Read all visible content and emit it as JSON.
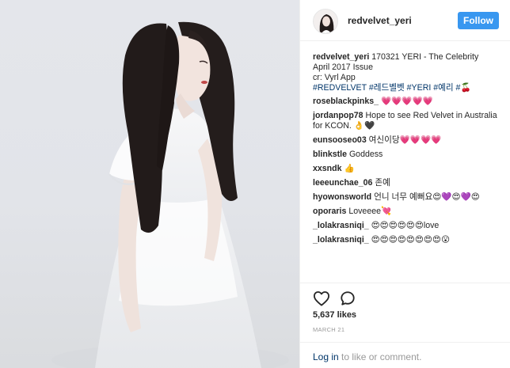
{
  "post": {
    "username": "redvelvet_yeri",
    "follow_label": "Follow",
    "caption": {
      "user": "redvelvet_yeri",
      "lines": [
        "170321 YERI - The Celebrity",
        "April 2017 Issue",
        "cr: Vyrl App"
      ],
      "hashtags": "#REDVELVET #레드벨벳 #YERI #예리 #🍒"
    },
    "comments": [
      {
        "user": "roseblackpinks_",
        "text": "💗💗💗💗💗"
      },
      {
        "user": "jordanpop78",
        "text": "Hope to see Red Velvet in Australia for KCON. 👌🖤"
      },
      {
        "user": "eunsooseo03",
        "text": "여신이당💗💗💗💗"
      },
      {
        "user": "blinkstle",
        "text": "Goddess"
      },
      {
        "user": "xxsndk",
        "text": "👍"
      },
      {
        "user": "leeeunchae_06",
        "text": "존예"
      },
      {
        "user": "hyowonsworld",
        "text": "언니 너무 예뻐요😍💜😍💜😍"
      },
      {
        "user": "oporaris",
        "text": "Loveeee💘"
      },
      {
        "user": "_lolakrasniqi_",
        "text": "😍😍😍😍😍😍love"
      },
      {
        "user": "_lolakrasniqi_",
        "text": "😍😍😍😍😍😍😍😍😮"
      }
    ],
    "likes": "5,637 likes",
    "date": "MARCH 21",
    "login": {
      "link": "Log in",
      "rest": " to like or comment."
    }
  },
  "icons": {
    "like": "heart-outline-icon",
    "comment": "speech-bubble-icon"
  },
  "colors": {
    "follow_button": "#3897f0",
    "link": "#003569",
    "muted": "#999999",
    "text": "#262626"
  }
}
